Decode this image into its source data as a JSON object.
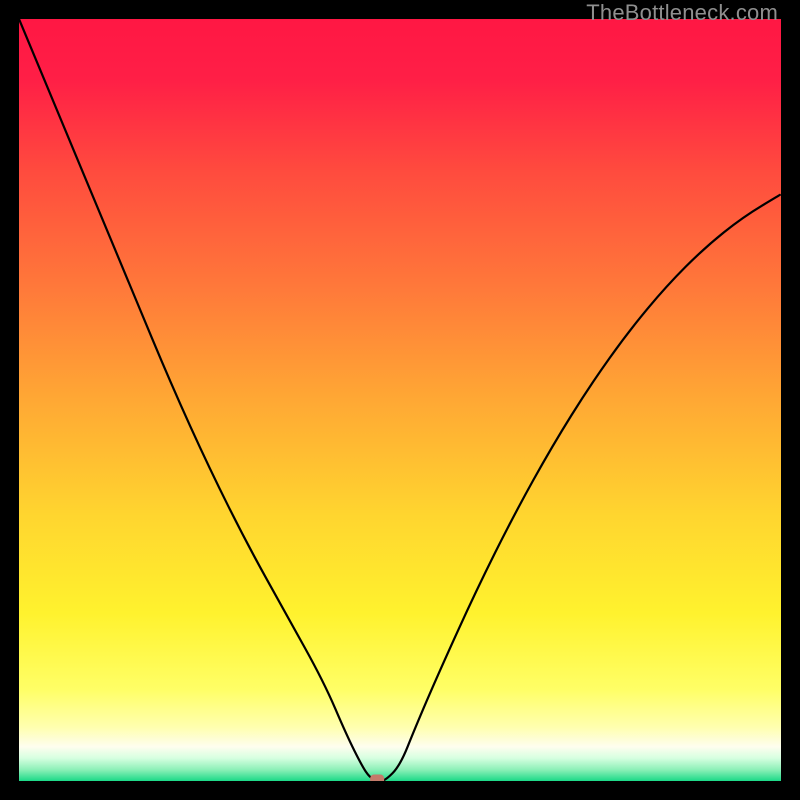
{
  "watermark": "TheBottleneck.com",
  "chart_data": {
    "type": "line",
    "title": "",
    "xlabel": "",
    "ylabel": "",
    "xlim": [
      0,
      100
    ],
    "ylim": [
      0,
      100
    ],
    "grid": false,
    "background": {
      "type": "vertical-gradient",
      "stops": [
        {
          "pos": 0.0,
          "color": "#ff1744"
        },
        {
          "pos": 0.08,
          "color": "#ff1f46"
        },
        {
          "pos": 0.2,
          "color": "#ff4b3e"
        },
        {
          "pos": 0.35,
          "color": "#ff783a"
        },
        {
          "pos": 0.5,
          "color": "#ffa834"
        },
        {
          "pos": 0.65,
          "color": "#ffd52f"
        },
        {
          "pos": 0.78,
          "color": "#fff22e"
        },
        {
          "pos": 0.88,
          "color": "#ffff66"
        },
        {
          "pos": 0.93,
          "color": "#ffffb0"
        },
        {
          "pos": 0.955,
          "color": "#fefeef"
        },
        {
          "pos": 0.97,
          "color": "#d6ffe0"
        },
        {
          "pos": 0.985,
          "color": "#8df0b8"
        },
        {
          "pos": 1.0,
          "color": "#1bd988"
        }
      ]
    },
    "series": [
      {
        "name": "bottleneck-curve",
        "x": [
          0,
          5,
          10,
          15,
          20,
          25,
          30,
          35,
          40,
          43,
          45,
          46,
          47,
          48,
          50,
          52,
          55,
          60,
          65,
          70,
          75,
          80,
          85,
          90,
          95,
          100
        ],
        "values": [
          100,
          88,
          76,
          64,
          52,
          41,
          31,
          22,
          13,
          6,
          2,
          0.5,
          0,
          0,
          2,
          7,
          14,
          25,
          35,
          44,
          52,
          59,
          65,
          70,
          74,
          77
        ]
      }
    ],
    "marker": {
      "name": "current-point",
      "x": 47,
      "y": 0.2,
      "color": "#c47a6a"
    }
  }
}
